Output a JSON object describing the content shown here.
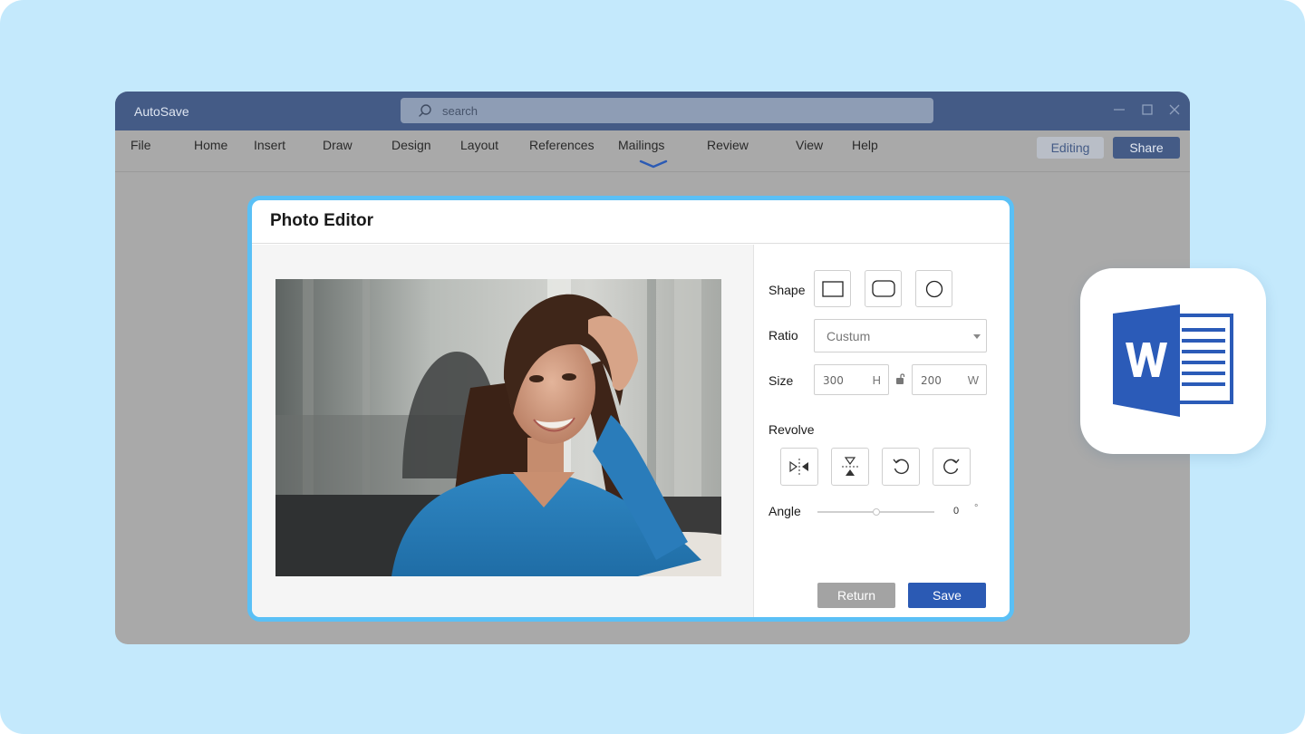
{
  "window": {
    "title": "AutoSave",
    "search": {
      "placeholder": "search",
      "value": ""
    }
  },
  "menu": {
    "items": [
      "File",
      "Home",
      "Insert",
      "Draw",
      "Design",
      "Layout",
      "References",
      "Mailings",
      "Review",
      "View",
      "Help"
    ],
    "editing_label": "Editing",
    "share_label": "Share"
  },
  "dialog": {
    "title": "Photo Editor",
    "shape_label": "Shape",
    "ratio_label": "Ratio",
    "ratio_value": "Custum",
    "size_label": "Size",
    "size_h_value": "300",
    "size_h_unit": "H",
    "size_w_value": "200",
    "size_w_unit": "W",
    "revolve_label": "Revolve",
    "angle_label": "Angle",
    "angle_value": "0",
    "angle_unit": "°",
    "return_label": "Return",
    "save_label": "Save"
  },
  "icons": {
    "search": "search-icon",
    "minimize": "minimize-icon",
    "maximize": "maximize-icon",
    "close": "close-icon",
    "shapes": [
      "rectangle-icon",
      "rounded-rectangle-icon",
      "circle-icon"
    ],
    "revolve": [
      "flip-horizontal-icon",
      "flip-vertical-icon",
      "rotate-left-icon",
      "rotate-right-icon"
    ],
    "lock": "unlock-icon",
    "app": "word-logo-icon"
  },
  "colors": {
    "background": "#c4e9fc",
    "titlebar": "#445b86",
    "dialog_border": "#5ac0f6",
    "accent": "#2b5ab4",
    "word_blue": "#2b5bb8"
  }
}
